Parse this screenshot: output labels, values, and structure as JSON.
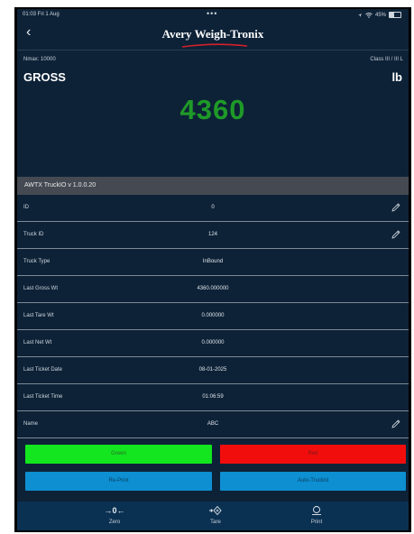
{
  "status_bar": {
    "time": "01:03 Fri 1 Aug",
    "dots": "•••",
    "battery": "45%",
    "battery_level": 0.45
  },
  "header": {
    "back": "‹",
    "logo": "Avery Weigh-Tronix"
  },
  "scale": {
    "nmax": "Nmax: 10000",
    "class": "Class III / III L",
    "mode": "GROSS",
    "unit": "lb",
    "weight": "4360"
  },
  "section_title": "AWTX TruckIO v 1.0.0.20",
  "rows": [
    {
      "label": "ID",
      "value": "0"
    },
    {
      "label": "Truck ID",
      "value": "124"
    },
    {
      "label": "Truck Type",
      "value": "InBound"
    },
    {
      "label": "Last Gross Wt",
      "value": "4360.000000"
    },
    {
      "label": "Last Tare Wt",
      "value": "0.000000"
    },
    {
      "label": "Last Net Wt",
      "value": "0.000000"
    },
    {
      "label": "Last Ticket Date",
      "value": "08-01-2025"
    },
    {
      "label": "Last Ticket Time",
      "value": "01:06:59"
    },
    {
      "label": "Name",
      "value": "ABC"
    }
  ],
  "buttons": {
    "green": "Green",
    "red": "Red",
    "reprint": "Re-Print",
    "auto": "Auto-TruckId"
  },
  "tabs": {
    "zero": "Zero",
    "tare": "Tare",
    "print": "Print"
  },
  "colors": {
    "background": "#0d2237",
    "weight": "#1f9a28",
    "green": "#13e51f",
    "red": "#f20d0d",
    "blue": "#0d8fd1",
    "tabbar": "#0b3152"
  }
}
